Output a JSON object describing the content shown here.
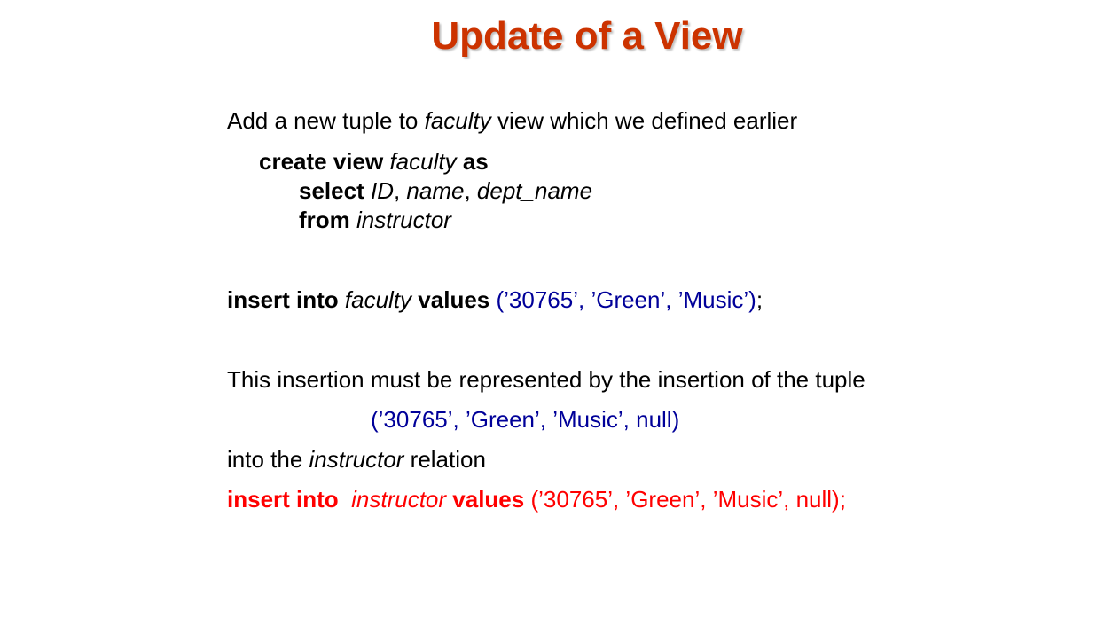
{
  "slide": {
    "title": "Update of a View"
  },
  "intro": {
    "pre": "Add a new tuple to ",
    "view_name": "faculty",
    "post": " view which we defined earlier"
  },
  "view_def": {
    "line1": {
      "kw_create_view": "create view",
      "name": "faculty",
      "kw_as": "as"
    },
    "line2": {
      "kw_select": "select",
      "col1": "ID",
      "sep1": ", ",
      "col2": "name",
      "sep2": ", ",
      "col3": "dept_name"
    },
    "line3": {
      "kw_from": "from",
      "table": "instructor"
    }
  },
  "insert_view": {
    "kw_insert_into": "insert into",
    "target": "faculty",
    "kw_values": "values",
    "tuple": "(’30765’, ’Green’, ’Music’)",
    "end": ";"
  },
  "explanation": {
    "text": "This insertion must be represented by the insertion of the tuple",
    "tuple": "(’30765’, ’Green’, ’Music’, null)",
    "into_pre": "into the ",
    "into_relation": "instructor",
    "into_post": " relation"
  },
  "insert_instructor": {
    "kw_insert_into": "insert into",
    "target": "instructor",
    "kw_values": "values",
    "tuple": "(’30765’, ’Green’, ’Music’, null);"
  },
  "colors": {
    "title": "#cc3300",
    "value_blue": "#000099",
    "highlight_red": "#ff0000"
  }
}
